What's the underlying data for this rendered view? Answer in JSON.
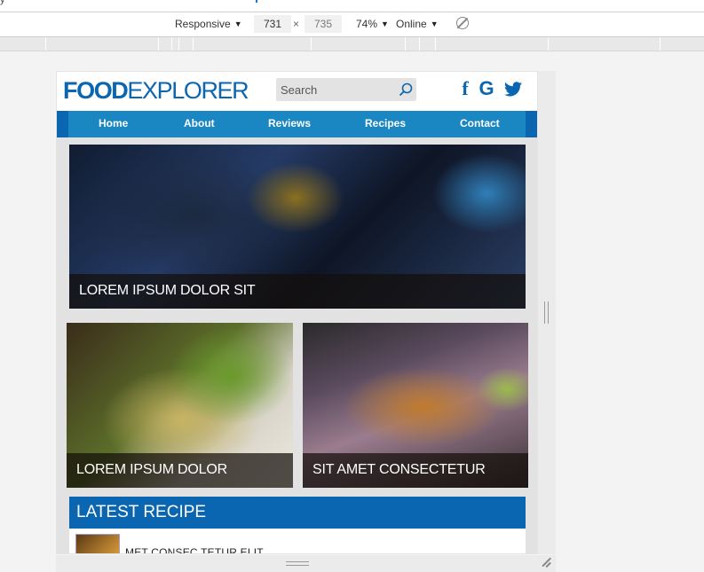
{
  "devtools": {
    "mode": "Responsive",
    "width": "731",
    "height": "735",
    "times": "×",
    "zoom": "74%",
    "network": "Online"
  },
  "site": {
    "logo_bold": "FOOD",
    "logo_light": "EXPLORER",
    "search_placeholder": "Search",
    "social": {
      "facebook": "f",
      "google": "G"
    },
    "nav": [
      "Home",
      "About",
      "Reviews",
      "Recipes",
      "Contact"
    ],
    "hero_caption": "LOREM IPSUM DOLOR SIT",
    "cards": [
      {
        "caption": "LOREM IPSUM DOLOR"
      },
      {
        "caption": "SIT AMET CONSECTETUR"
      }
    ],
    "latest_heading": "LATEST RECIPE",
    "latest_items": [
      {
        "title": "MET CONSEC TETUR ELIT"
      }
    ]
  },
  "colors": {
    "brand": "#0a66b0",
    "nav": "#1b87c2"
  }
}
